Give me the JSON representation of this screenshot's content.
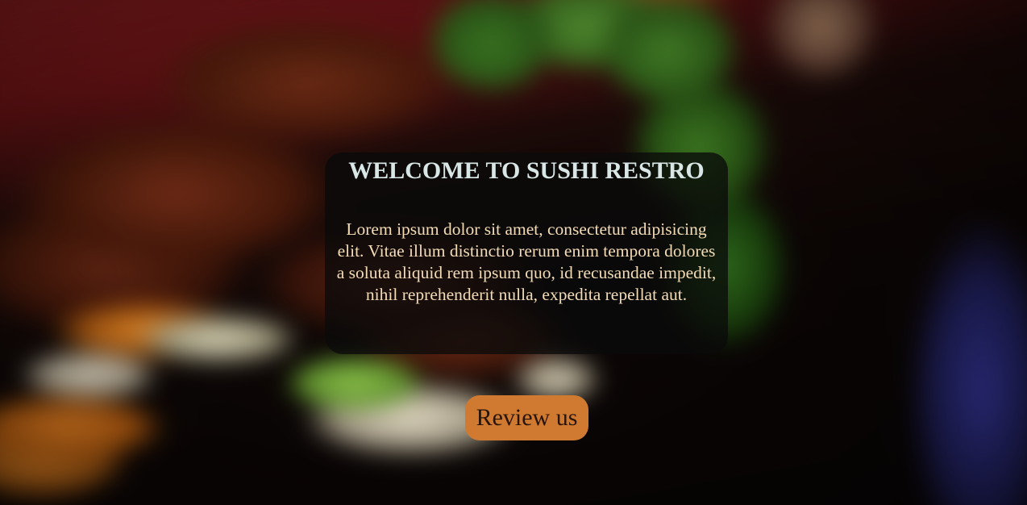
{
  "hero": {
    "title": "WELCOME TO SUSHI RESTRO",
    "body": "Lorem ipsum dolor sit amet, consectetur adipisicing elit. Vitae illum distinctio rerum enim tempora dolores a soluta aliquid rem ipsum quo, id recusandae impedit, nihil reprehenderit nulla, expedita repellat aut.",
    "background": "food-photo"
  },
  "cta": {
    "label": "Review us"
  },
  "colors": {
    "card_bg": "#0a0a0a",
    "title_text": "#d9e6e6",
    "body_text": "#f3dcb6",
    "button_bg": "#cf7a30",
    "button_text": "#2a1406"
  }
}
